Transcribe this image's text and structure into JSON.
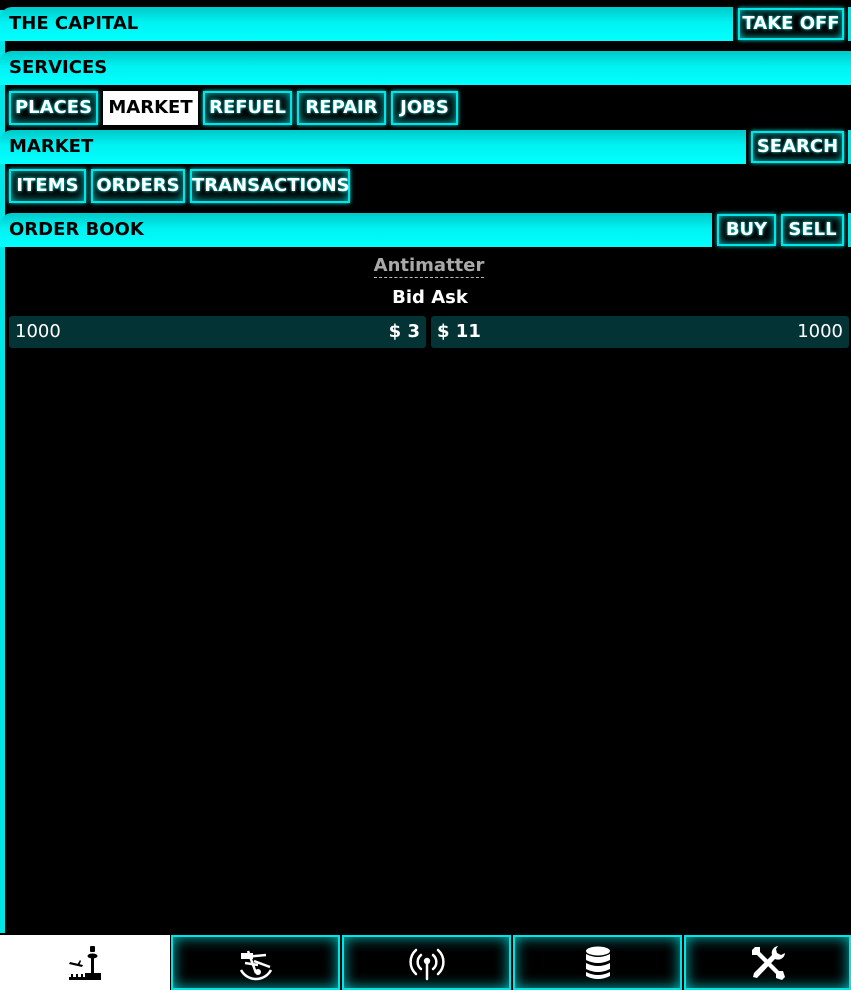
{
  "location": {
    "title": "THE CAPITAL",
    "take_off_label": "TAKE OFF"
  },
  "services": {
    "title": "SERVICES",
    "tabs": [
      {
        "label": "PLACES",
        "active": false
      },
      {
        "label": "MARKET",
        "active": true
      },
      {
        "label": "REFUEL",
        "active": false
      },
      {
        "label": "REPAIR",
        "active": false
      },
      {
        "label": "JOBS",
        "active": false
      }
    ]
  },
  "market": {
    "title": "MARKET",
    "search_label": "SEARCH",
    "tabs": [
      {
        "label": "ITEMS"
      },
      {
        "label": "ORDERS"
      },
      {
        "label": "TRANSACTIONS"
      }
    ]
  },
  "order_book": {
    "title": "ORDER BOOK",
    "buy_label": "BUY",
    "sell_label": "SELL",
    "commodity": "Antimatter",
    "column_header": "Bid Ask",
    "bid": {
      "quantity": "1000",
      "price": "$ 3"
    },
    "ask": {
      "price": "$ 11",
      "quantity": "1000"
    }
  },
  "bottom_nav": [
    {
      "icon": "spaceport-icon",
      "active": true
    },
    {
      "icon": "sextant-icon",
      "active": false
    },
    {
      "icon": "antenna-icon",
      "active": false
    },
    {
      "icon": "database-icon",
      "active": false
    },
    {
      "icon": "tools-icon",
      "active": false
    }
  ],
  "colors": {
    "accent": "#00e5e5",
    "row_bg": "#043335",
    "background": "#000000"
  }
}
